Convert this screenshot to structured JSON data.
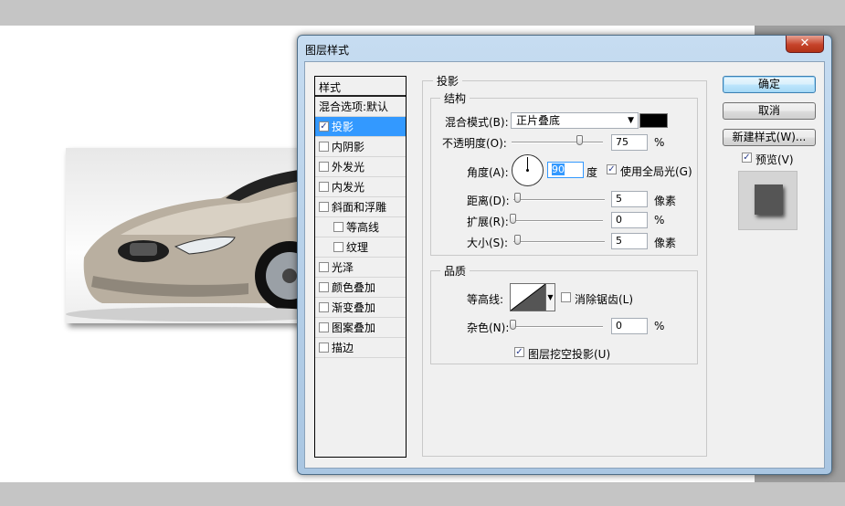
{
  "dialog": {
    "title": "图层样式",
    "close_label": "✕"
  },
  "styles_panel": {
    "header": "样式",
    "items": [
      {
        "label": "混合选项:默认",
        "checkbox": false,
        "checked": false,
        "indent": false,
        "active": false
      },
      {
        "label": "投影",
        "checkbox": true,
        "checked": true,
        "indent": false,
        "active": true
      },
      {
        "label": "内阴影",
        "checkbox": true,
        "checked": false,
        "indent": false,
        "active": false
      },
      {
        "label": "外发光",
        "checkbox": true,
        "checked": false,
        "indent": false,
        "active": false
      },
      {
        "label": "内发光",
        "checkbox": true,
        "checked": false,
        "indent": false,
        "active": false
      },
      {
        "label": "斜面和浮雕",
        "checkbox": true,
        "checked": false,
        "indent": false,
        "active": false
      },
      {
        "label": "等高线",
        "checkbox": true,
        "checked": false,
        "indent": true,
        "active": false
      },
      {
        "label": "纹理",
        "checkbox": true,
        "checked": false,
        "indent": true,
        "active": false
      },
      {
        "label": "光泽",
        "checkbox": true,
        "checked": false,
        "indent": false,
        "active": false
      },
      {
        "label": "颜色叠加",
        "checkbox": true,
        "checked": false,
        "indent": false,
        "active": false
      },
      {
        "label": "渐变叠加",
        "checkbox": true,
        "checked": false,
        "indent": false,
        "active": false
      },
      {
        "label": "图案叠加",
        "checkbox": true,
        "checked": false,
        "indent": false,
        "active": false
      },
      {
        "label": "描边",
        "checkbox": true,
        "checked": false,
        "indent": false,
        "active": false
      }
    ]
  },
  "drop_shadow": {
    "section_title": "投影",
    "structure": {
      "title": "结构",
      "blend_mode_label": "混合模式(B):",
      "blend_mode_value": "正片叠底",
      "shadow_color": "#000000",
      "opacity_label": "不透明度(O):",
      "opacity_value": "75",
      "opacity_unit": "%",
      "opacity_level": 0.75,
      "angle_label": "角度(A):",
      "angle_value": "90",
      "angle_unit": "度",
      "global_light_label": "使用全局光(G)",
      "global_light_checked": true,
      "distance_label": "距离(D):",
      "distance_value": "5",
      "distance_unit": "像素",
      "spread_label": "扩展(R):",
      "spread_value": "0",
      "spread_unit": "%",
      "size_label": "大小(S):",
      "size_value": "5",
      "size_unit": "像素"
    },
    "quality": {
      "title": "品质",
      "contour_label": "等高线:",
      "anti_alias_label": "消除锯齿(L)",
      "anti_alias_checked": false,
      "noise_label": "杂色(N):",
      "noise_value": "0",
      "noise_unit": "%"
    },
    "knockout_label": "图层挖空投影(U)",
    "knockout_checked": true
  },
  "buttons": {
    "ok": "确定",
    "cancel": "取消",
    "new_style": "新建样式(W)...",
    "preview_label": "预览(V)",
    "preview_checked": true
  },
  "colors": {
    "selection": "#3399ff",
    "dialog_frame": "#a9c6e2",
    "close_button": "#c6432a"
  }
}
